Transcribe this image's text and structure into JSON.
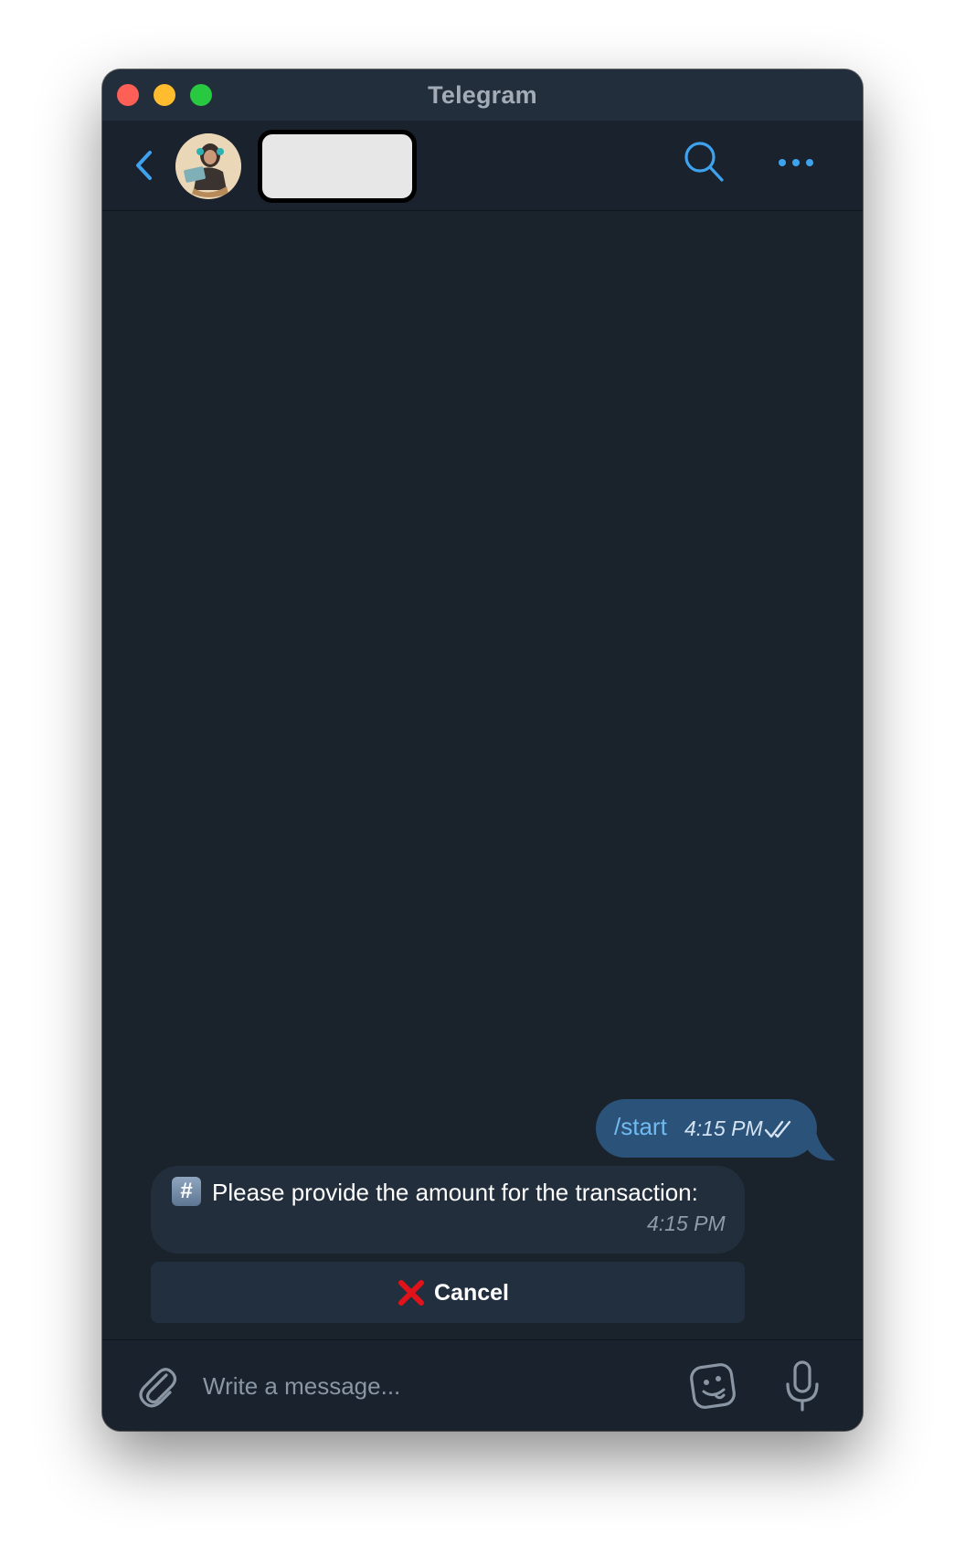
{
  "window": {
    "title": "Telegram"
  },
  "header": {
    "contact_name": "",
    "icons": {
      "back": "chevron-left-icon",
      "search": "search-icon",
      "more": "more-dots-icon"
    },
    "accent_color": "#3fa2ef"
  },
  "messages": [
    {
      "direction": "outgoing",
      "text": "/start",
      "time": "4:15 PM",
      "status": "read"
    },
    {
      "direction": "incoming",
      "emoji": "#",
      "text": "Please provide the amount for the transaction:",
      "time": "4:15 PM"
    }
  ],
  "inline_keyboard": {
    "buttons": [
      {
        "icon": "red-x-icon",
        "label": "Cancel"
      }
    ]
  },
  "composer": {
    "placeholder": "Write a message...",
    "icons": {
      "attach": "paperclip-icon",
      "sticker": "sticker-icon",
      "mic": "microphone-icon"
    }
  }
}
